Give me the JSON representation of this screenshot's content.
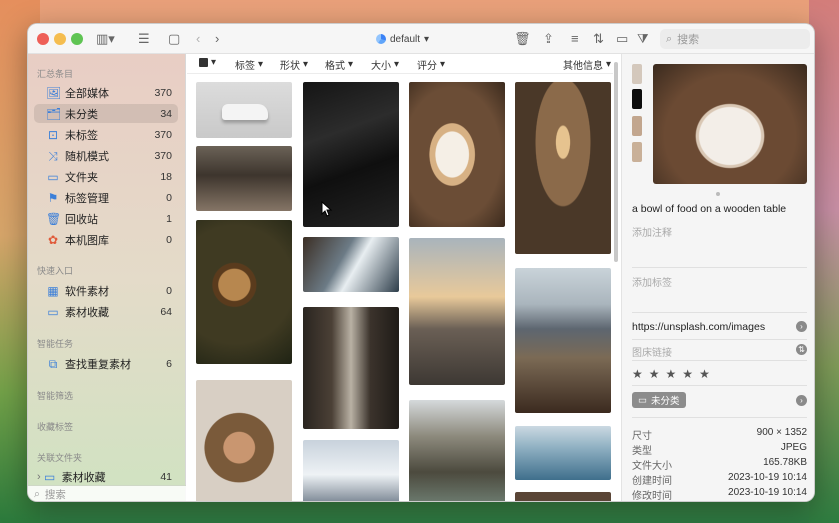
{
  "toolbar": {
    "library": "default",
    "search_placeholder": "搜索"
  },
  "sidebar": {
    "sections": [
      {
        "title": "汇总条目"
      },
      {
        "title": "快速入口"
      },
      {
        "title": "智能任务"
      },
      {
        "title": "智能筛选"
      },
      {
        "title": "收藏标签"
      },
      {
        "title": "关联文件夹"
      }
    ],
    "items": [
      {
        "label": "全部媒体",
        "count": "370",
        "icon": "images-icon"
      },
      {
        "label": "未分类",
        "count": "34",
        "icon": "uncategorized-icon"
      },
      {
        "label": "未标签",
        "count": "370",
        "icon": "untagged-icon"
      },
      {
        "label": "随机模式",
        "count": "370",
        "icon": "shuffle-icon"
      },
      {
        "label": "文件夹",
        "count": "18",
        "icon": "folder-icon"
      },
      {
        "label": "标签管理",
        "count": "0",
        "icon": "tag-icon"
      },
      {
        "label": "回收站",
        "count": "1",
        "icon": "trash-icon"
      },
      {
        "label": "本机图库",
        "count": "0",
        "icon": "photos-icon"
      },
      {
        "label": "软件素材",
        "count": "0",
        "icon": "grid-icon"
      },
      {
        "label": "素材收藏",
        "count": "64",
        "icon": "folder-icon"
      },
      {
        "label": "查找重复素材",
        "count": "6",
        "icon": "duplicate-icon"
      },
      {
        "label": "素材收藏",
        "count": "41",
        "icon": "folder-icon"
      }
    ],
    "search_placeholder": "搜索"
  },
  "filterbar": {
    "items": [
      "标签",
      "形状",
      "格式",
      "大小",
      "评分"
    ],
    "more": "其他信息"
  },
  "inspector": {
    "swatches": [
      "#d4c8bc",
      "#0d0d0d",
      "#c2a68e",
      "#c9b098"
    ],
    "title": "a bowl of food on a wooden table",
    "annotation_placeholder": "添加注释",
    "tag_placeholder": "添加标签",
    "url": "https://unsplash.com/images",
    "image_link_placeholder": "图床链接",
    "folder": "未分类",
    "meta": [
      {
        "k": "尺寸",
        "v": "900 × 1352"
      },
      {
        "k": "类型",
        "v": "JPEG"
      },
      {
        "k": "文件大小",
        "v": "165.78KB"
      },
      {
        "k": "创建时间",
        "v": "2023-10-19 10:14"
      },
      {
        "k": "修改时间",
        "v": "2023-10-19 10:14"
      }
    ]
  },
  "colors": {
    "accent": "#3b7fd9",
    "selected": "#dcdcdc"
  }
}
